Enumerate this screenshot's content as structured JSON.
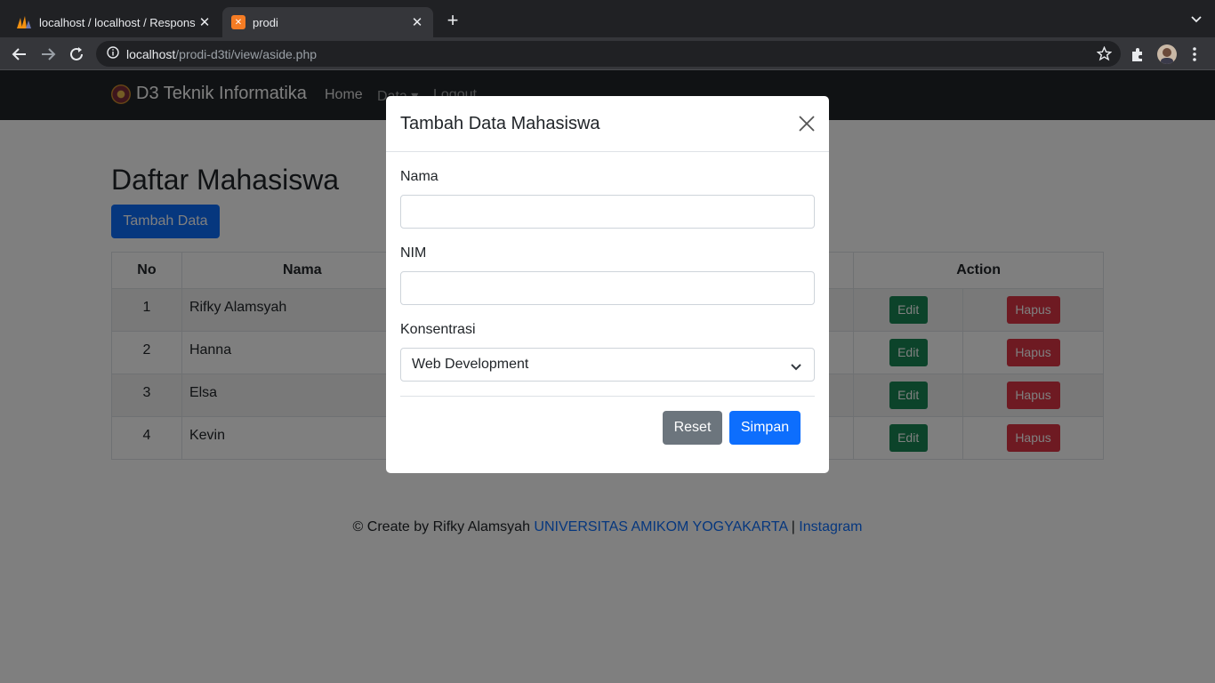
{
  "browser": {
    "tabs": [
      {
        "title": "localhost / localhost / Respons",
        "favicon": "phpmyadmin-icon",
        "active": false
      },
      {
        "title": "prodi",
        "favicon": "xampp-icon",
        "active": true
      }
    ],
    "url_host": "localhost",
    "url_path": "/prodi-d3ti/view/aside.php"
  },
  "navbar": {
    "brand": "D3 Teknik Informatika",
    "links": [
      "Home",
      "Data",
      "Logout"
    ]
  },
  "main": {
    "title": "Daftar Mahasiswa",
    "add_button": "Tambah Data",
    "table": {
      "headers": {
        "no": "No",
        "nama": "Nama",
        "action": "Action"
      },
      "rows": [
        {
          "no": "1",
          "nama": "Rifky Alamsyah",
          "edit": "Edit",
          "hapus": "Hapus"
        },
        {
          "no": "2",
          "nama": "Hanna",
          "edit": "Edit",
          "hapus": "Hapus"
        },
        {
          "no": "3",
          "nama": "Elsa",
          "edit": "Edit",
          "hapus": "Hapus"
        },
        {
          "no": "4",
          "nama": "Kevin",
          "edit": "Edit",
          "hapus": "Hapus"
        }
      ]
    }
  },
  "footer": {
    "text": "© Create by Rifky Alamsyah",
    "link1": "UNIVERSITAS AMIKOM YOGYAKARTA",
    "separator": "|",
    "link2": "Instagram"
  },
  "modal": {
    "title": "Tambah Data Mahasiswa",
    "fields": {
      "nama_label": "Nama",
      "nama_value": "",
      "nim_label": "NIM",
      "nim_value": "",
      "konsentrasi_label": "Konsentrasi",
      "konsentrasi_value": "Web Development"
    },
    "reset_label": "Reset",
    "simpan_label": "Simpan"
  },
  "colors": {
    "primary": "#0d6efd",
    "success": "#198754",
    "danger": "#dc3545",
    "secondary": "#6c757d",
    "navbar": "#212529"
  }
}
